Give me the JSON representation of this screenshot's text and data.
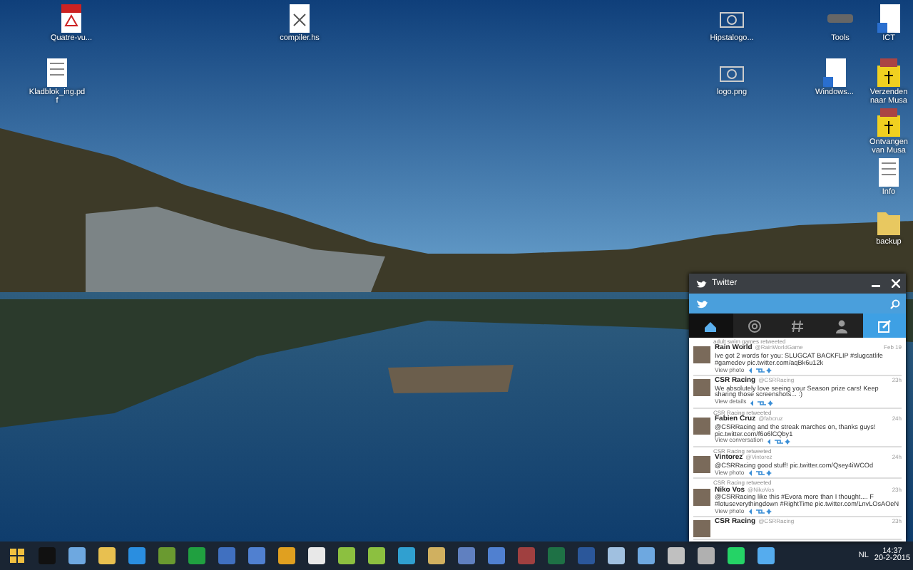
{
  "desktop_icons": [
    {
      "label": "Quatre-vu...",
      "kind": "pdf"
    },
    {
      "label": "compiler.hs",
      "kind": "file"
    },
    {
      "label": "Kladblok_ing.pd f",
      "kind": "doc"
    },
    {
      "label": "Hipstalogo...",
      "kind": "image"
    },
    {
      "label": "logo.png",
      "kind": "image"
    },
    {
      "label": "Tools",
      "kind": "drive"
    },
    {
      "label": "ICT",
      "kind": "shortcut"
    },
    {
      "label": "Windows...",
      "kind": "shortcut"
    },
    {
      "label": "Verzenden naar Musa",
      "kind": "archive"
    },
    {
      "label": "Ontvangen van Musa",
      "kind": "archive"
    },
    {
      "label": "Info",
      "kind": "doc"
    },
    {
      "label": "backup",
      "kind": "folder"
    }
  ],
  "twitter_window": {
    "title": "Twitter",
    "tabs": [
      {
        "kind": "home",
        "selected": true
      },
      {
        "kind": "mentions",
        "selected": false
      },
      {
        "kind": "hashtag",
        "selected": false
      },
      {
        "kind": "profile",
        "selected": false
      }
    ],
    "tweets": [
      {
        "retweeted_by": "adult swim games retweeted",
        "name": "Rain World",
        "handle": "@RainWorldGame",
        "time": "Feb 19",
        "text": "Ive got 2 words for you: SLUGCAT BACKFLIP #slugcatlife #gamedev pic.twitter.com/aqBk6u12k",
        "action": "View photo"
      },
      {
        "name": "CSR Racing",
        "handle": "@CSRRacing",
        "time": "23h",
        "text": "We absolutely love seeing your Season prize cars! Keep sharing those screenshots... :)",
        "action": "View details"
      },
      {
        "retweeted_by": "CSR Racing retweeted",
        "name": "Fabien Cruz",
        "handle": "@fabcruz",
        "time": "24h",
        "text": "@CSRRacing and the streak marches on, thanks guys! pic.twitter.com/f6o6lCQby1",
        "action": "View conversation"
      },
      {
        "retweeted_by": "CSR Racing retweeted",
        "name": "Vintorez",
        "handle": "@Vintorez",
        "time": "24h",
        "text": "@CSRRacing good stuff! pic.twitter.com/Qsey4iWCOd",
        "action": "View photo"
      },
      {
        "retweeted_by": "CSR Racing retweeted",
        "name": "Niko Vos",
        "handle": "@NikoVos",
        "time": "23h",
        "text": "@CSRRacing like this #Evora more than I thought.... F #lotuseverythingdown #RightTime pic.twitter.com/LnvLOsAOeN",
        "action": "View photo"
      },
      {
        "name": "CSR Racing",
        "handle": "@CSRRacing",
        "time": "23h"
      }
    ]
  },
  "taskbar": {
    "apps": [
      {
        "kind": "terminal"
      },
      {
        "kind": "window"
      },
      {
        "kind": "folder"
      },
      {
        "kind": "remote"
      },
      {
        "kind": "vm"
      },
      {
        "kind": "vpn"
      },
      {
        "kind": "network"
      },
      {
        "kind": "computer"
      },
      {
        "kind": "outlook"
      },
      {
        "kind": "settings"
      },
      {
        "kind": "android"
      },
      {
        "kind": "android"
      },
      {
        "kind": "sync"
      },
      {
        "kind": "image"
      },
      {
        "kind": "chart"
      },
      {
        "kind": "computer"
      },
      {
        "kind": "archive"
      },
      {
        "kind": "excel"
      },
      {
        "kind": "word"
      },
      {
        "kind": "notes"
      },
      {
        "kind": "window"
      },
      {
        "kind": "gear"
      },
      {
        "kind": "tools"
      },
      {
        "kind": "whatsapp"
      },
      {
        "kind": "twitter"
      }
    ],
    "language": "NL",
    "time": "14:37",
    "date": "20-2-2015"
  }
}
